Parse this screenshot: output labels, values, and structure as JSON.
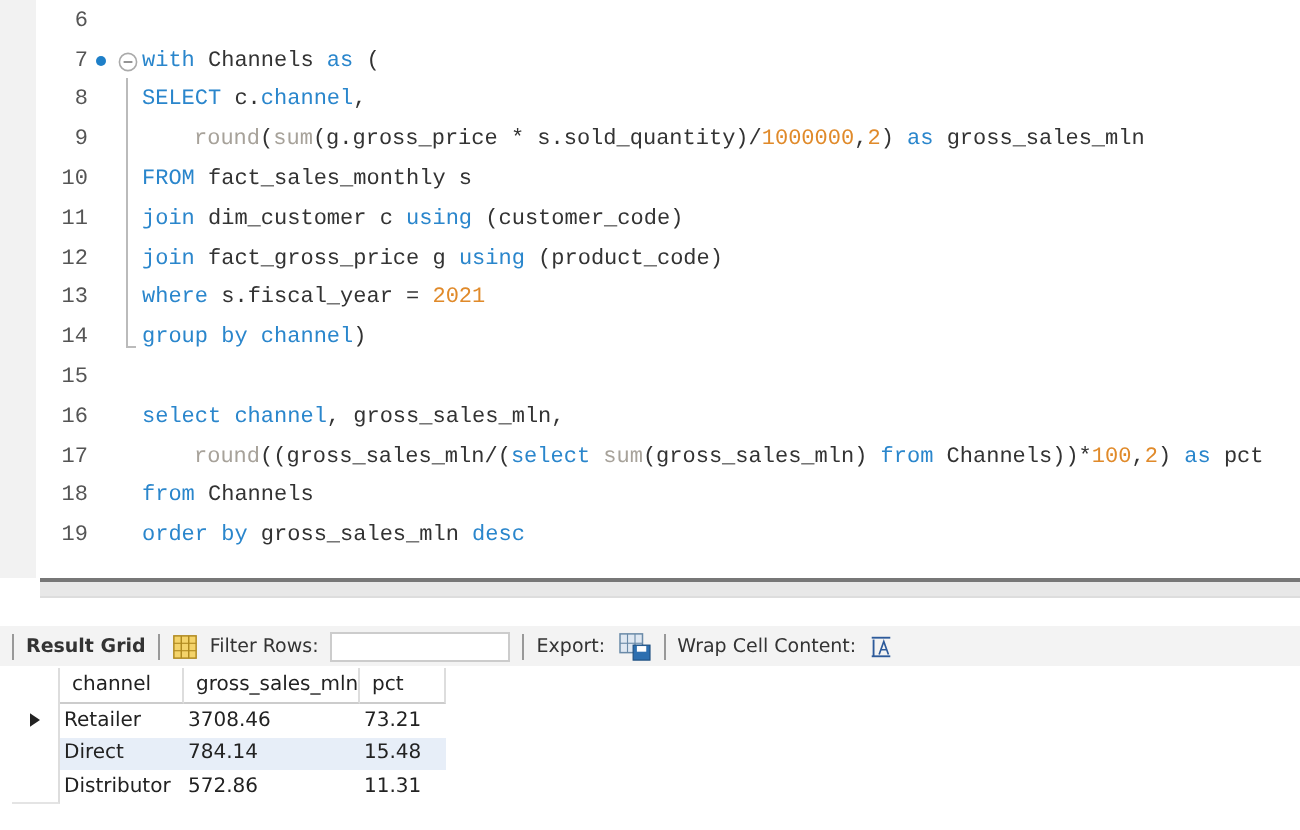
{
  "editor": {
    "lines": [
      {
        "number": "6"
      },
      {
        "number": "7",
        "breakpoint": true,
        "fold_start": true,
        "tokens": [
          {
            "t": "with",
            "kind": "kw"
          },
          {
            "t": " Channels ",
            "kind": "plain"
          },
          {
            "t": "as",
            "kind": "kw"
          },
          {
            "t": " (",
            "kind": "plain"
          }
        ]
      },
      {
        "number": "8",
        "tokens": [
          {
            "t": "SELECT",
            "kind": "kw"
          },
          {
            "t": " c.",
            "kind": "plain"
          },
          {
            "t": "channel",
            "kind": "kw"
          },
          {
            "t": ",",
            "kind": "plain"
          }
        ]
      },
      {
        "number": "9",
        "indented": true,
        "tokens": [
          {
            "t": "round",
            "kind": "fn"
          },
          {
            "t": "(",
            "kind": "plain"
          },
          {
            "t": "sum",
            "kind": "fn"
          },
          {
            "t": "(g.gross_price * s.sold_quantity)/",
            "kind": "plain"
          },
          {
            "t": "1000000",
            "kind": "num"
          },
          {
            "t": ",",
            "kind": "plain"
          },
          {
            "t": "2",
            "kind": "num"
          },
          {
            "t": ") ",
            "kind": "plain"
          },
          {
            "t": "as",
            "kind": "kw"
          },
          {
            "t": " gross_sales_mln",
            "kind": "plain"
          }
        ]
      },
      {
        "number": "10",
        "tokens": [
          {
            "t": "FROM",
            "kind": "kw"
          },
          {
            "t": " fact_sales_monthly s",
            "kind": "plain"
          }
        ]
      },
      {
        "number": "11",
        "tokens": [
          {
            "t": "join",
            "kind": "kw"
          },
          {
            "t": " dim_customer c ",
            "kind": "plain"
          },
          {
            "t": "using",
            "kind": "kw"
          },
          {
            "t": " (customer_code)",
            "kind": "plain"
          }
        ]
      },
      {
        "number": "12",
        "tokens": [
          {
            "t": "join",
            "kind": "kw"
          },
          {
            "t": " fact_gross_price g ",
            "kind": "plain"
          },
          {
            "t": "using",
            "kind": "kw"
          },
          {
            "t": " (product_code)",
            "kind": "plain"
          }
        ]
      },
      {
        "number": "13",
        "tokens": [
          {
            "t": "where",
            "kind": "kw"
          },
          {
            "t": " s.fiscal_year = ",
            "kind": "plain"
          },
          {
            "t": "2021",
            "kind": "num"
          }
        ]
      },
      {
        "number": "14",
        "fold_end": true,
        "tokens": [
          {
            "t": "group by channel",
            "kind": "kw"
          },
          {
            "t": ")",
            "kind": "plain"
          }
        ]
      },
      {
        "number": "15"
      },
      {
        "number": "16",
        "tokens": [
          {
            "t": "select channel",
            "kind": "kw"
          },
          {
            "t": ", gross_sales_mln,",
            "kind": "plain"
          }
        ]
      },
      {
        "number": "17",
        "indented": true,
        "tokens": [
          {
            "t": "round",
            "kind": "fn"
          },
          {
            "t": "((gross_sales_mln/(",
            "kind": "plain"
          },
          {
            "t": "select",
            "kind": "kw"
          },
          {
            "t": " sum",
            "kind": "fn"
          },
          {
            "t": "(gross_sales_mln) ",
            "kind": "plain"
          },
          {
            "t": "from",
            "kind": "kw"
          },
          {
            "t": " Channels))*",
            "kind": "plain"
          },
          {
            "t": "100",
            "kind": "num"
          },
          {
            "t": ",",
            "kind": "plain"
          },
          {
            "t": "2",
            "kind": "num"
          },
          {
            "t": ") ",
            "kind": "plain"
          },
          {
            "t": "as",
            "kind": "kw"
          },
          {
            "t": " pct",
            "kind": "plain"
          }
        ]
      },
      {
        "number": "18",
        "tokens": [
          {
            "t": "from",
            "kind": "kw"
          },
          {
            "t": " Channels",
            "kind": "plain"
          }
        ]
      },
      {
        "number": "19",
        "tokens": [
          {
            "t": "order by",
            "kind": "kw"
          },
          {
            "t": " gross_sales_mln ",
            "kind": "plain"
          },
          {
            "t": "desc",
            "kind": "kw"
          }
        ]
      }
    ]
  },
  "toolbar": {
    "result_grid": "Result Grid",
    "filter_label": "Filter Rows:",
    "export_label": "Export:",
    "wrap_label": "Wrap Cell Content:"
  },
  "table": {
    "columns": [
      "channel",
      "gross_sales_mln",
      "pct"
    ],
    "rows": [
      {
        "cells": [
          "Retailer",
          "3708.46",
          "73.21"
        ],
        "current": true,
        "selected": false
      },
      {
        "cells": [
          "Direct",
          "784.14",
          "15.48"
        ],
        "current": false,
        "selected": true
      },
      {
        "cells": [
          "Distributor",
          "572.86",
          "11.31"
        ],
        "current": false,
        "selected": false
      }
    ]
  }
}
